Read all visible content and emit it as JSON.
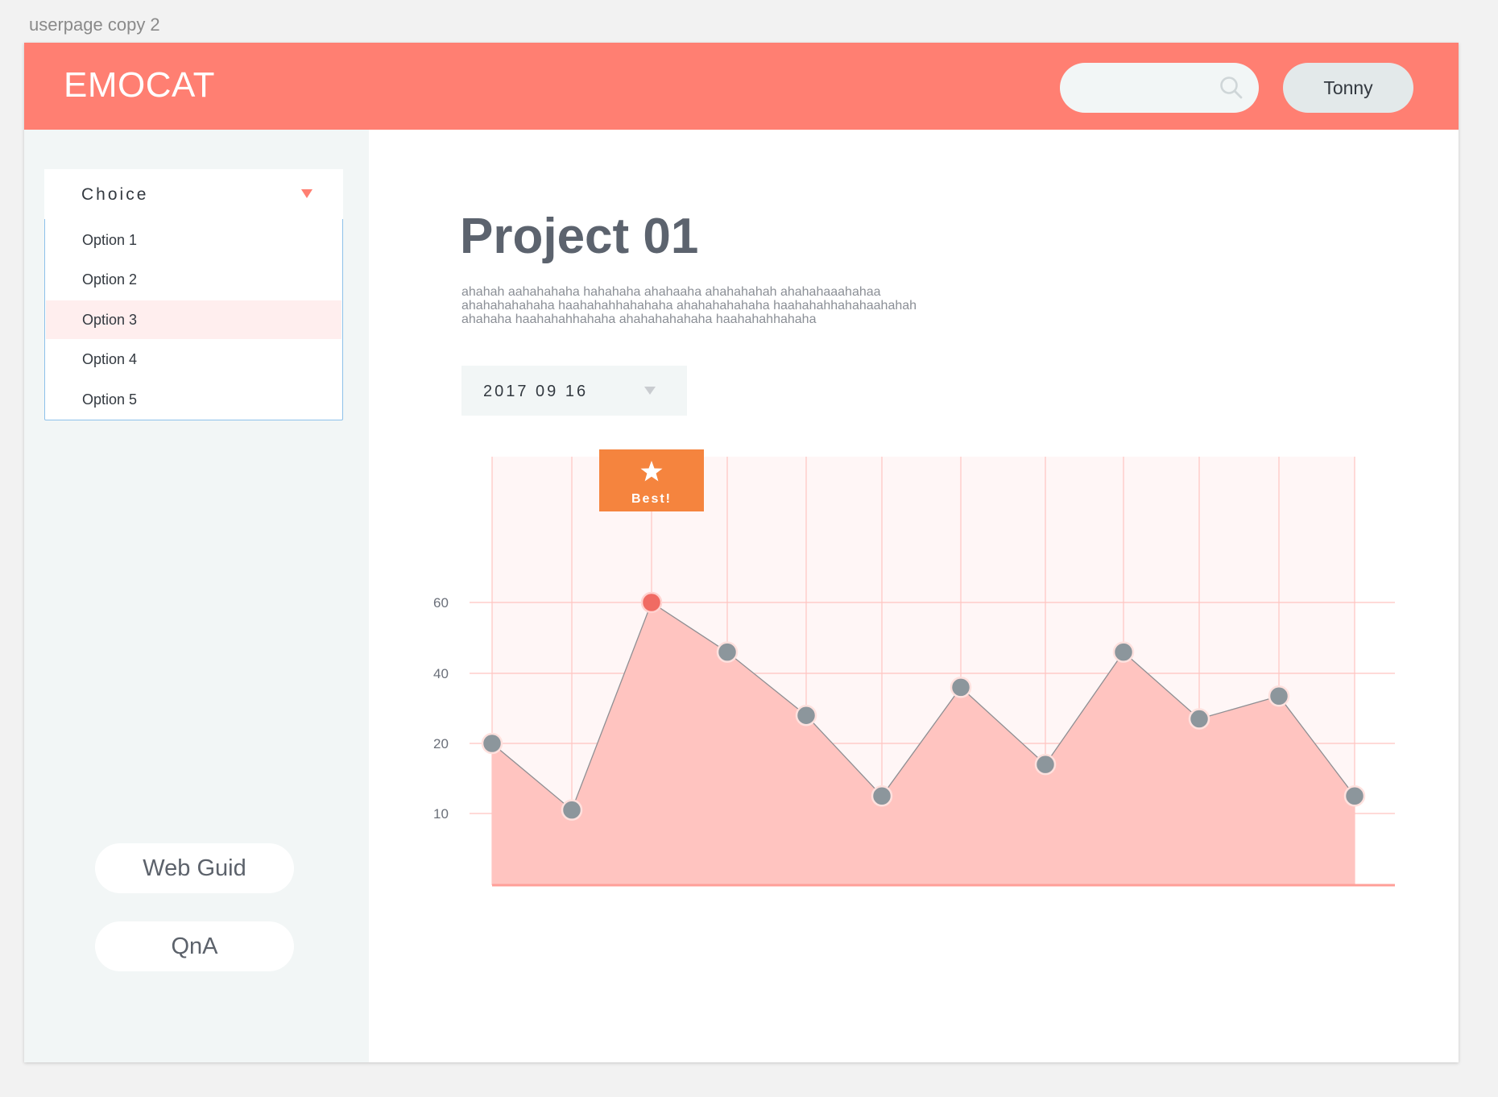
{
  "artboard": {
    "label": "userpage copy 2"
  },
  "header": {
    "logo": "EMOCAT",
    "search": {
      "placeholder": ""
    },
    "user_button": "Tonny"
  },
  "sidebar": {
    "dropdown": {
      "label": "Choice",
      "options": [
        "Option 1",
        "Option 2",
        "Option 3",
        "Option 4",
        "Option 5"
      ],
      "highlighted": "Option 3"
    },
    "links": [
      "Web Guid",
      "QnA"
    ]
  },
  "main": {
    "title": "Project 01",
    "description": [
      "ahahah aahahahaha hahahaha ahahaaha  ahahahahah ahahahaaahahaa",
      "ahahahahahaha haahahahhahahaha ahahahahahaha haahahahhahahaahahah",
      "ahahaha haahahahhahaha ahahahahahaha haahahahhahaha"
    ],
    "date_select": "2017 09 16"
  },
  "colors": {
    "header": "#ff7f72",
    "area_fill": "#ffc4c0",
    "plot_bg": "#fff6f6",
    "grid": "#ffc4c0",
    "point": "#8c969c",
    "best_point": "#f06b63",
    "best_badge": "#f5843e"
  },
  "icons": {
    "search": "search-icon",
    "best": "star-icon",
    "dropdown_caret": "caret-down-icon"
  },
  "chart_data": {
    "type": "area",
    "x": [
      1,
      2,
      3,
      4,
      5,
      6,
      7,
      8,
      9,
      10,
      11,
      12
    ],
    "values": [
      20,
      10.5,
      60,
      46,
      28,
      12.5,
      36,
      17,
      46,
      27,
      33.5,
      12.5
    ],
    "ytick_labels": [
      "60",
      "40",
      "20",
      "10"
    ],
    "grid": true,
    "annotation": {
      "label": "Best!",
      "point_index": 2
    }
  }
}
